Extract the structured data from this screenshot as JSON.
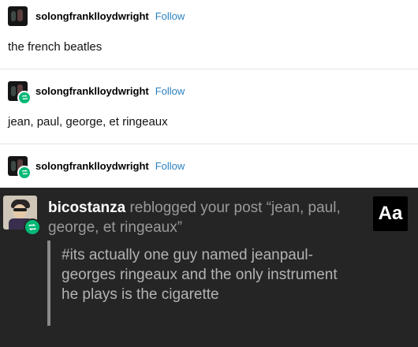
{
  "posts": [
    {
      "username": "solongfranklloydwright",
      "follow_label": "Follow",
      "text": "the french beatles",
      "reblogged": false
    },
    {
      "username": "solongfranklloydwright",
      "follow_label": "Follow",
      "text": "jean, paul, george, et ringeaux",
      "reblogged": true
    },
    {
      "username": "solongfranklloydwright",
      "follow_label": "Follow",
      "reblogged": true
    }
  ],
  "notification": {
    "user": "bicostanza",
    "action_text": "reblogged your post “jean, paul, george, et ringeaux”",
    "tags": "#its actually one guy named jeanpaul-georges ringeaux and the only instrument he plays is the cigarette",
    "font_button_label": "Aa"
  },
  "icons": {
    "avatar": "user-avatar",
    "reblog": "reblog-icon"
  },
  "colors": {
    "follow": "#2a7fbf",
    "reblog_badge": "#02b875",
    "notification_bg": "#252525"
  }
}
